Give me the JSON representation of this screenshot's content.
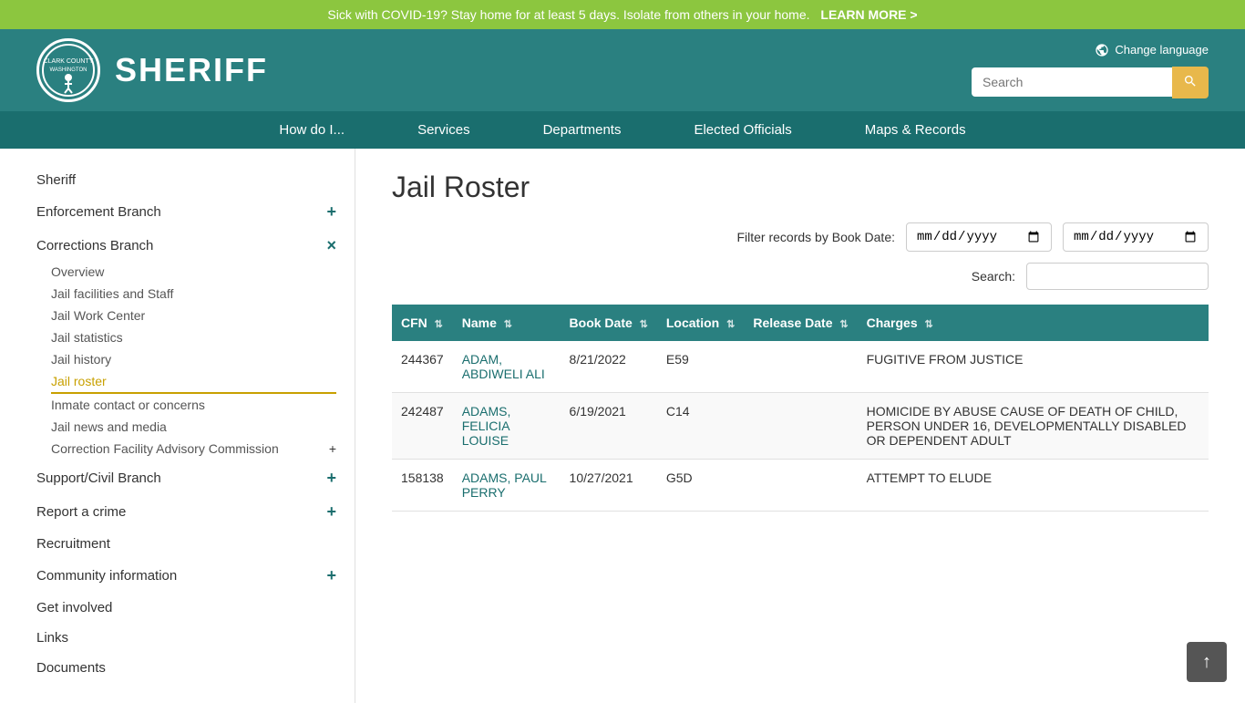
{
  "covid_banner": {
    "text": "Sick with COVID-19? Stay home for at least 5 days. Isolate from others in your home.",
    "link_text": "LEARN MORE >"
  },
  "header": {
    "logo_alt": "Clark County Washington",
    "title": "SHERIFF",
    "change_language_label": "Change language",
    "search_placeholder": "Search"
  },
  "nav": {
    "items": [
      {
        "label": "How do I..."
      },
      {
        "label": "Services"
      },
      {
        "label": "Departments"
      },
      {
        "label": "Elected Officials"
      },
      {
        "label": "Maps & Records"
      }
    ]
  },
  "sidebar": {
    "items": [
      {
        "label": "Sheriff",
        "type": "main"
      },
      {
        "label": "Enforcement Branch",
        "type": "main-expand",
        "expand": "+"
      },
      {
        "label": "Corrections Branch",
        "type": "main-expand",
        "expand": "×",
        "sub_items": [
          {
            "label": "Overview",
            "active": false
          },
          {
            "label": "Jail facilities and Staff",
            "active": false
          },
          {
            "label": "Jail Work Center",
            "active": false
          },
          {
            "label": "Jail statistics",
            "active": false
          },
          {
            "label": "Jail history",
            "active": false
          },
          {
            "label": "Jail roster",
            "active": true
          },
          {
            "label": "Inmate contact or concerns",
            "active": false
          },
          {
            "label": "Jail news and media",
            "active": false
          },
          {
            "label": "Correction Facility Advisory Commission",
            "active": false,
            "expand": "+"
          }
        ]
      },
      {
        "label": "Support/Civil Branch",
        "type": "main-expand",
        "expand": "+"
      },
      {
        "label": "Report a crime",
        "type": "main-expand",
        "expand": "+"
      },
      {
        "label": "Recruitment",
        "type": "main"
      },
      {
        "label": "Community information",
        "type": "main-expand",
        "expand": "+"
      },
      {
        "label": "Get involved",
        "type": "main"
      },
      {
        "label": "Links",
        "type": "main"
      },
      {
        "label": "Documents",
        "type": "main"
      }
    ]
  },
  "page": {
    "title": "Jail Roster",
    "filter_label": "Filter records by Book Date:",
    "search_label": "Search:",
    "date_placeholder_1": "mm/dd/yyyy",
    "date_placeholder_2": "mm/dd/yyyy"
  },
  "table": {
    "columns": [
      {
        "key": "cfn",
        "label": "CFN",
        "sortable": true
      },
      {
        "key": "name",
        "label": "Name",
        "sortable": true
      },
      {
        "key": "book_date",
        "label": "Book Date",
        "sortable": true
      },
      {
        "key": "location",
        "label": "Location",
        "sortable": true
      },
      {
        "key": "release_date",
        "label": "Release Date",
        "sortable": true
      },
      {
        "key": "charges",
        "label": "Charges",
        "sortable": true
      }
    ],
    "rows": [
      {
        "cfn": "244367",
        "name": "ADAM, ABDIWELI ALI",
        "book_date": "8/21/2022",
        "location": "E59",
        "release_date": "",
        "charges": "FUGITIVE FROM JUSTICE"
      },
      {
        "cfn": "242487",
        "name": "ADAMS, FELICIA LOUISE",
        "book_date": "6/19/2021",
        "location": "C14",
        "release_date": "",
        "charges": "HOMICIDE BY ABUSE CAUSE OF DEATH OF CHILD, PERSON UNDER 16, DEVELOPMENTALLY DISABLED OR DEPENDENT ADULT"
      },
      {
        "cfn": "158138",
        "name": "ADAMS, PAUL PERRY",
        "book_date": "10/27/2021",
        "location": "G5D",
        "release_date": "",
        "charges": "ATTEMPT TO ELUDE"
      }
    ]
  },
  "scroll_top_label": "↑"
}
